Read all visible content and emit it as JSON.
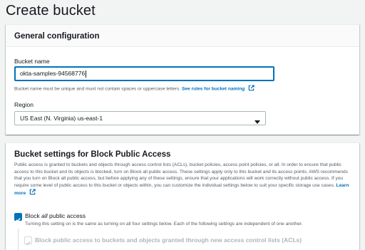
{
  "page": {
    "title": "Create bucket"
  },
  "general": {
    "title": "General configuration",
    "bucket_name_label": "Bucket name",
    "bucket_name_value": "okta-samples-94568776",
    "bucket_name_hint": "Bucket name must be unique and must not contain spaces or uppercase letters.",
    "rules_link": "See rules for bucket naming",
    "region_label": "Region",
    "region_value": "US East (N. Virginia) us-east-1"
  },
  "block_public": {
    "title": "Bucket settings for Block Public Access",
    "description": "Public access is granted to buckets and objects through access control lists (ACLs), bucket policies, access point policies, or all. In order to ensure that public access to this bucket and its objects is blocked, turn on Block all public access. These settings apply only to this bucket and its access points. AWS recommends that you turn on Block all public access, but before applying any of these settings, ensure that your applications will work correctly without public access. If you require some level of public access to this bucket or objects within, you can customize the individual settings below to suit your specific storage use cases.",
    "learn_more": "Learn more",
    "block_all_prefix": "Block ",
    "block_all_em": "all",
    "block_all_suffix": " public access",
    "block_all_checked": true,
    "block_all_desc": "Turning this setting on is the same as turning on all four settings below. Each of the following settings are independent of one another.",
    "acl_label": "Block public access to buckets and objects granted through new access control lists (ACLs)",
    "acl_checked": true
  },
  "colors": {
    "link": "#0073bb",
    "checkbox_checked": "#0073bb",
    "input_focus_border": "#0073bb",
    "background": "#f2f3f3"
  },
  "icons": [
    "external-link-icon",
    "chevron-down-icon",
    "checkmark-icon"
  ]
}
